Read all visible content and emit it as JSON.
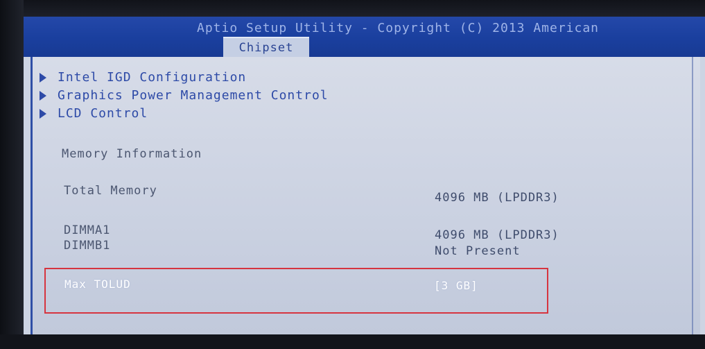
{
  "bios": {
    "title": "Aptio Setup Utility - Copyright (C) 2013 American",
    "active_tab": "Chipset"
  },
  "submenus": [
    {
      "label": "Intel IGD Configuration"
    },
    {
      "label": "Graphics Power Management Control"
    },
    {
      "label": "LCD Control"
    }
  ],
  "memory": {
    "section_title": "Memory Information",
    "total_label": "Total Memory",
    "total_value": "4096 MB (LPDDR3)",
    "dimm_a_label": "DIMMA1",
    "dimm_a_value": "4096 MB (LPDDR3)",
    "dimm_b_label": "DIMMB1",
    "dimm_b_value": "Not Present"
  },
  "selected_option": {
    "label": "Max TOLUD",
    "value": "[3 GB]"
  },
  "colors": {
    "header_bg": "#1a3f9e",
    "panel_bg": "#cdd4e3",
    "menu_text": "#2d4aa7",
    "highlight_box": "#d6343f"
  }
}
